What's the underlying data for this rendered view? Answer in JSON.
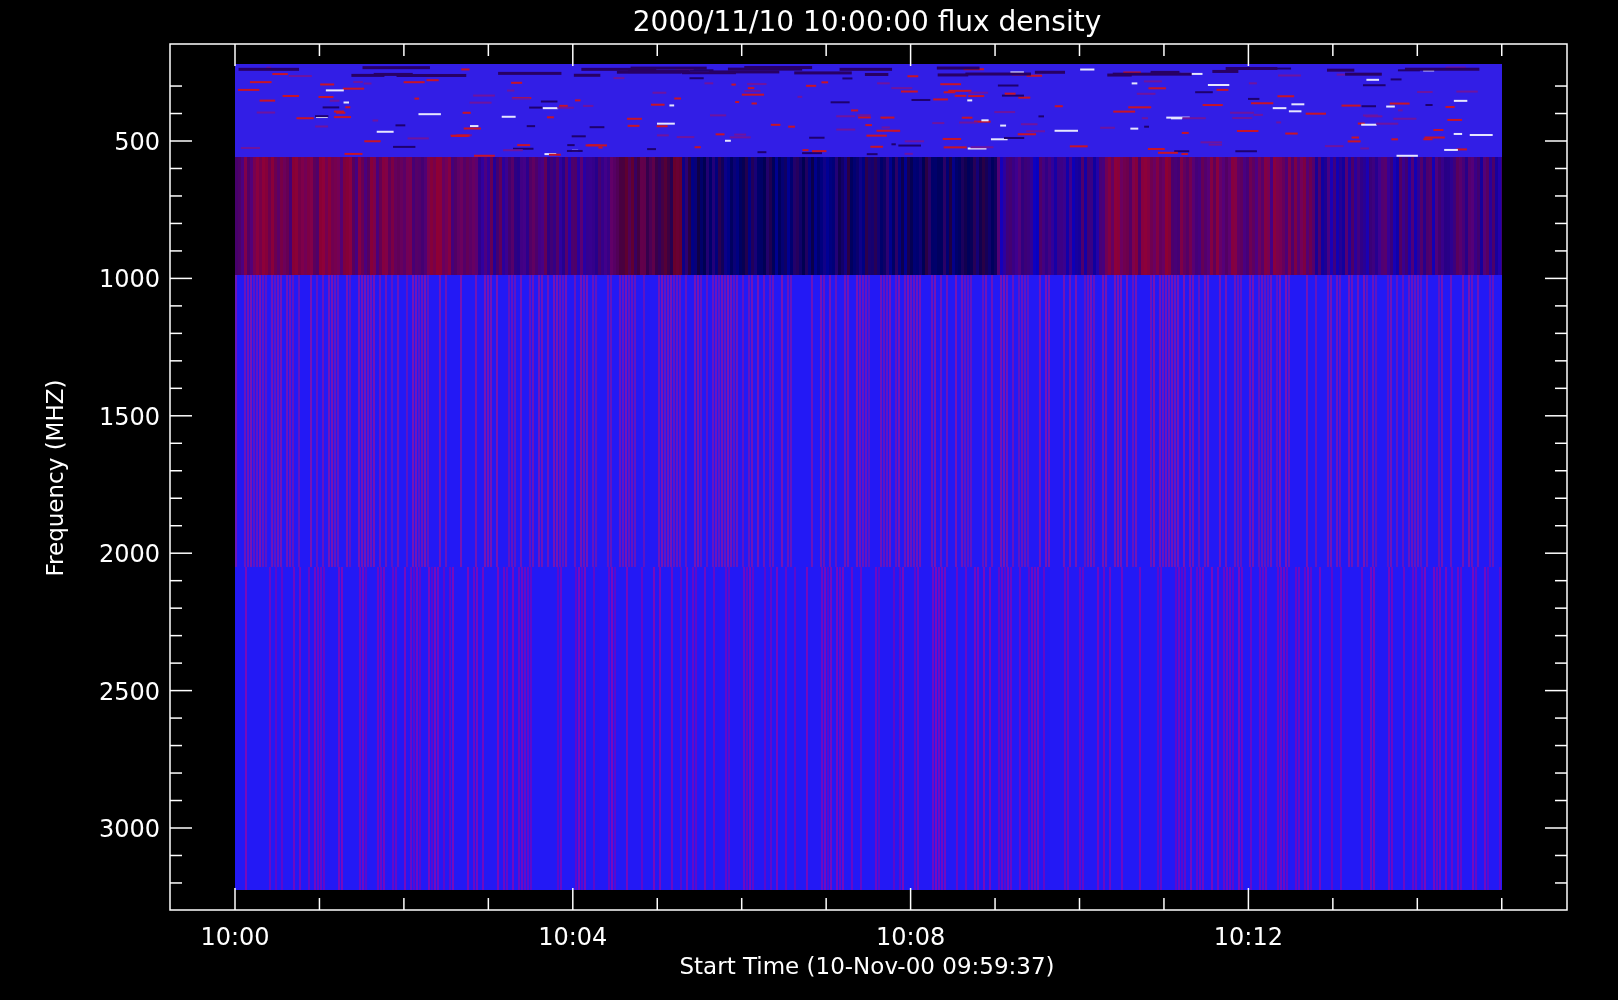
{
  "title": "2000/11/10 10:00:00 flux density",
  "y_axis": {
    "label": "Frequency (MHZ)",
    "ticks": [
      "500",
      "1000",
      "1500",
      "2000",
      "2500",
      "3000"
    ]
  },
  "x_axis": {
    "label": "Start Time (10-Nov-00 09:59:37)",
    "ticks": [
      "10:00",
      "10:04",
      "10:08",
      "10:12"
    ]
  }
}
